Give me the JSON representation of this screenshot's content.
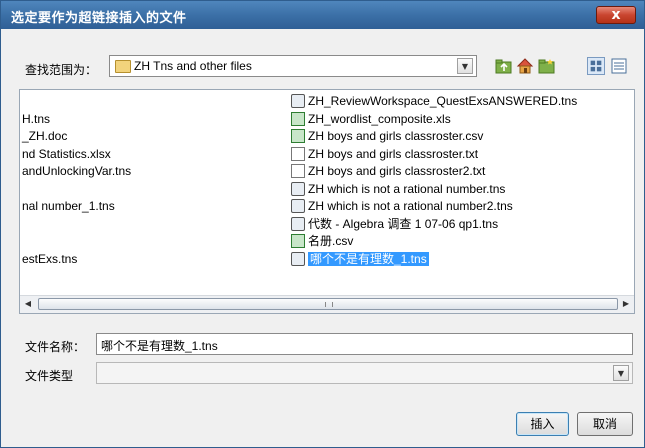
{
  "dialog": {
    "title": "选定要作为超链接插入的文件",
    "close_label": "x"
  },
  "toolbar": {
    "lookin_label": "查找范围为：",
    "lookin_value": "ZH Tns and other files"
  },
  "files": [
    {
      "name": "ZH_ReviewWorkspace_QuestExsANSWERED.tns",
      "icon": "tns-file-icon"
    },
    {
      "name": "ZH_wordlist_composite.xls",
      "icon": "xls-file-icon"
    },
    {
      "name": "ZH boys and girls classroster.csv",
      "icon": "csv-file-icon"
    },
    {
      "name": "ZH boys and girls classroster.txt",
      "icon": "txt-file-icon"
    },
    {
      "name": "ZH boys and girls classroster2.txt",
      "icon": "txt-file-icon"
    },
    {
      "name": "ZH which is not a rational number.tns",
      "icon": "tns-file-icon"
    },
    {
      "name": "ZH which is not a rational number2.tns",
      "icon": "tns-file-icon"
    },
    {
      "name": "代数 - Algebra 调查 1 07-06 qp1.tns",
      "icon": "tns-file-icon"
    },
    {
      "name": "名册.csv",
      "icon": "csv-file-icon"
    },
    {
      "name": "哪个不是有理数_1.tns",
      "icon": "tns-file-icon",
      "selected": true
    }
  ],
  "files_left": [
    "H.tns",
    "_ZH.doc",
    "nd Statistics.xlsx",
    "andUnlockingVar.tns",
    "nal number_1.tns",
    "estExs.tns"
  ],
  "form": {
    "filename_label": "文件名称：",
    "filename_value": "哪个不是有理数_1.tns",
    "filetype_label": "文件类型",
    "filetype_value": ""
  },
  "buttons": {
    "insert": "插入",
    "cancel": "取消"
  }
}
